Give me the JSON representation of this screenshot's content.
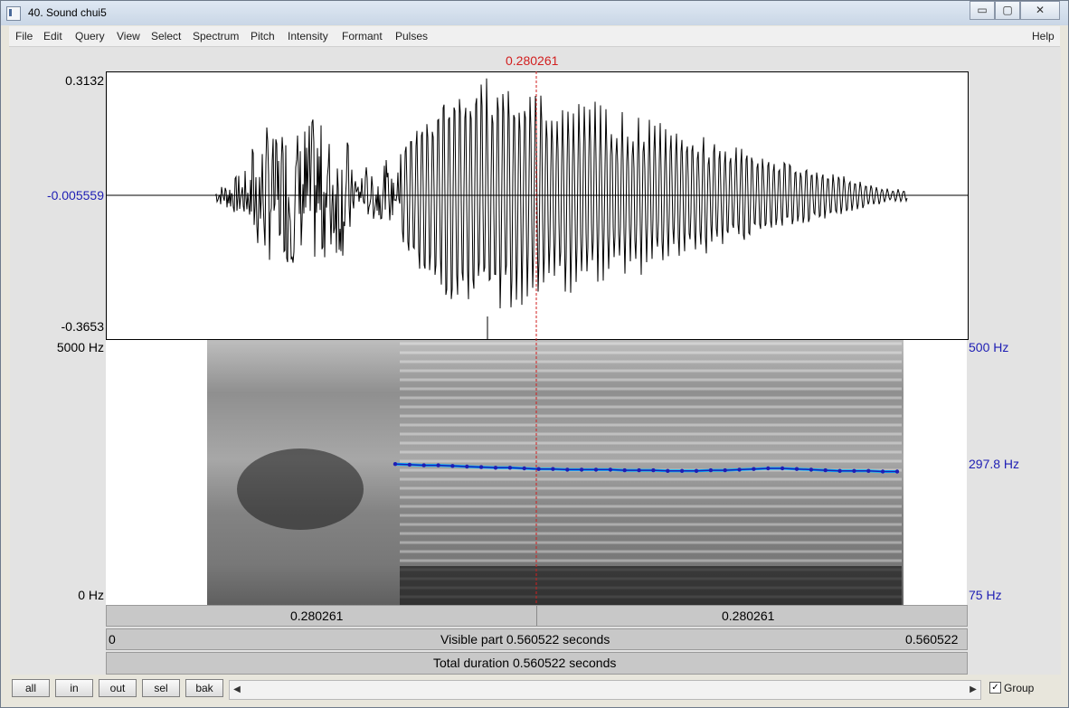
{
  "window": {
    "title": "40. Sound chui5",
    "min_glyph": "▭",
    "max_glyph": "▢",
    "close_glyph": "✕"
  },
  "menu": {
    "items": [
      "File",
      "Edit",
      "Query",
      "View",
      "Select",
      "Spectrum",
      "Pitch",
      "Intensity",
      "Formant",
      "Pulses"
    ],
    "help": "Help"
  },
  "waveform": {
    "max_label": "0.3132",
    "zero_label": "-0.005559",
    "min_label": "-0.3653",
    "cursor_label": "0.280261"
  },
  "spectrogram": {
    "top_left": "5000 Hz",
    "bottom_left": "0 Hz",
    "top_right": "500 Hz",
    "pitch_right": "297.8 Hz",
    "bottom_right": "75 Hz",
    "pitch_hz": [
      301,
      300,
      299,
      299,
      298,
      297,
      296,
      295,
      295,
      294,
      293,
      293,
      292,
      292,
      292,
      292,
      291,
      291,
      291,
      290,
      290,
      290,
      291,
      291,
      292,
      293,
      294,
      294,
      293,
      292,
      291,
      290,
      290,
      290,
      289,
      289
    ]
  },
  "time": {
    "left_segment": "0.280261",
    "right_segment": "0.280261",
    "visible_start": "0",
    "visible_label": "Visible part 0.560522 seconds",
    "visible_end": "0.560522",
    "total_label": "Total duration 0.560522 seconds",
    "cursor_s": 0.280261,
    "duration_s": 0.560522
  },
  "controls": {
    "all": "all",
    "in": "in",
    "out": "out",
    "sel": "sel",
    "bak": "bak",
    "group_label": "Group",
    "group_checked": "✓"
  },
  "colors": {
    "cursor": "#d21e1e",
    "pitch": "#1e1eb4",
    "axis_blue": "#1e1eb4"
  }
}
